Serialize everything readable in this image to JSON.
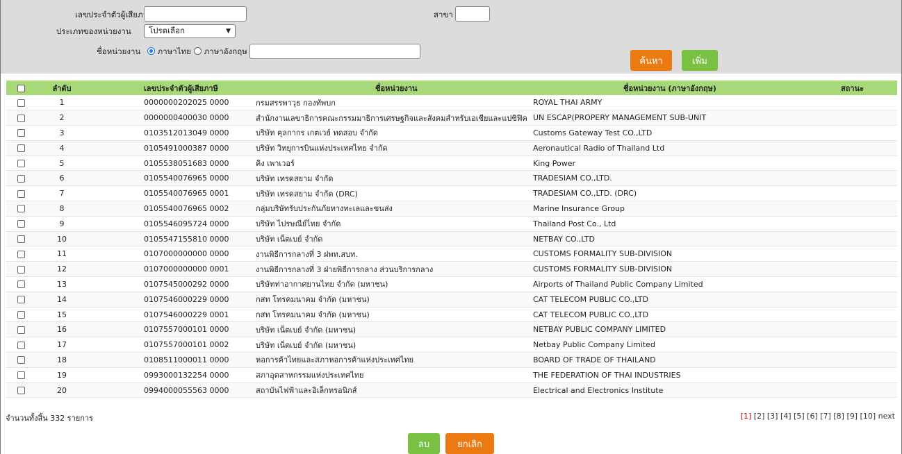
{
  "filter": {
    "tax_id_label": "เลขประจำตัวผู้เสียภาษี",
    "tax_id_value": "",
    "branch_label": "สาขา",
    "branch_value": "",
    "unit_type_label": "ประเภทของหน่วยงาน",
    "unit_type_selected": "โปรดเลือก",
    "unit_name_label": "ชื่อหน่วยงาน",
    "lang_thai_label": "ภาษาไทย",
    "lang_eng_label": "ภาษาอังกฤษ",
    "lang_selected": "thai",
    "unit_name_value": "",
    "search_label": "ค้นหา",
    "add_label": "เพิ่ม"
  },
  "table": {
    "headers": [
      "ลำดับ",
      "เลขประจำตัวผู้เสียภาษี",
      "ชื่อหน่วยงาน",
      "ชื่อหน่วยงาน (ภาษาอังกฤษ)",
      "สถานะ"
    ],
    "rows": [
      [
        "1",
        "0000000202025 0000",
        "กรมสรรพาวุธ กองทัพบก",
        "ROYAL THAI ARMY",
        ""
      ],
      [
        "2",
        "0000000400030 0000",
        "สำนักงานเลขาธิการคณะกรรมมาธิการเศรษฐกิจและสังคมสำหรับเอเชียและแปซิฟิค",
        "UN ESCAP(PROPERY MANAGEMENT SUB-UNIT",
        ""
      ],
      [
        "3",
        "0103512013049 0000",
        "บริษัท คุลกากร เกตเวย์ ทดสอบ จำกัด",
        "Customs Gateway Test CO.,LTD",
        ""
      ],
      [
        "4",
        "0105491000387 0000",
        "บริษัท วิทยุการบินแห่งประเทศไทย จำกัด",
        "Aeronautical Radio of Thailand Ltd",
        ""
      ],
      [
        "5",
        "0105538051683 0000",
        "คิง เพาเวอร์",
        "King Power",
        ""
      ],
      [
        "6",
        "0105540076965 0000",
        "บริษัท เทรดสยาม จำกัด",
        "TRADESIAM CO.,LTD.",
        ""
      ],
      [
        "7",
        "0105540076965 0001",
        "บริษัท เทรดสยาม จำกัด (DRC)",
        "TRADESIAM CO.,LTD. (DRC)",
        ""
      ],
      [
        "8",
        "0105540076965 0002",
        "กลุ่มบริษัทรับประกันภัยทางทะเลและขนส่ง",
        "Marine Insurance Group",
        ""
      ],
      [
        "9",
        "0105546095724 0000",
        "บริษัท ไปรษณีย์ไทย จำกัด",
        "Thailand Post Co., Ltd",
        ""
      ],
      [
        "10",
        "0105547155810 0000",
        "บริษัท เน็ตเบย์ จำกัด",
        "NETBAY CO.,LTD",
        ""
      ],
      [
        "11",
        "0107000000000 0000",
        "งานพิธีการกลางที่ 3 ฝพท.สบท.",
        "CUSTOMS FORMALITY SUB-DIVISION",
        ""
      ],
      [
        "12",
        "0107000000000 0001",
        "งานพิธีการกลางที่ 3 ฝ่ายพิธีการกลาง ส่วนบริการกลาง",
        "CUSTOMS FORMALITY SUB-DIVISION",
        ""
      ],
      [
        "13",
        "0107545000292 0000",
        "บริษัทท่าอากาศยานไทย จำกัด (มหาชน)",
        "Airports of Thailand Public Company Limited",
        ""
      ],
      [
        "14",
        "0107546000229 0000",
        "กสท โทรคมนาคม จำกัด (มหาชน)",
        "CAT TELECOM PUBLIC CO.,LTD",
        ""
      ],
      [
        "15",
        "0107546000229 0001",
        "กสท โทรคมนาคม จำกัด (มหาชน)",
        "CAT TELECOM PUBLIC CO.,LTD",
        ""
      ],
      [
        "16",
        "0107557000101 0000",
        "บริษัท เน็ตเบย์ จำกัด (มหาชน)",
        "NETBAY PUBLIC COMPANY LIMITED",
        ""
      ],
      [
        "17",
        "0107557000101 0002",
        "บริษัท เน็ตเบย์ จำกัด (มหาชน)",
        "Netbay Public Company Limited",
        ""
      ],
      [
        "18",
        "0108511000011 0000",
        "หอการค้าไทยและสภาหอการค้าแห่งประเทศไทย",
        "BOARD OF TRADE OF THAILAND",
        ""
      ],
      [
        "19",
        "0993000132254 0000",
        "สภาอุตสาหกรรมแห่งประเทศไทย",
        "THE FEDERATION OF THAI INDUSTRIES",
        ""
      ],
      [
        "20",
        "0994000055563 0000",
        "สถาบันไฟฟ้าและอิเล็กทรอนิกส์",
        "Electrical and Electronics Institute",
        ""
      ]
    ]
  },
  "footer": {
    "total_text": "จำนวนทั้งสิ้น 332 รายการ",
    "pages": [
      "1",
      "2",
      "3",
      "4",
      "5",
      "6",
      "7",
      "8",
      "9",
      "10"
    ],
    "current_page": "1",
    "next_label": "next",
    "delete_label": "ลบ",
    "cancel_label": "ยกเลิก"
  }
}
